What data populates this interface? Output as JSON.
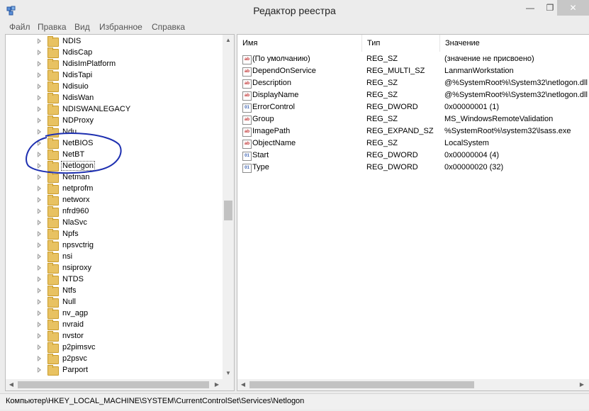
{
  "window": {
    "title": "Редактор реестра",
    "minimize_glyph": "—",
    "maximize_glyph": "❐",
    "close_glyph": "✕"
  },
  "menu": [
    "Файл",
    "Правка",
    "Вид",
    "Избранное",
    "Справка"
  ],
  "tree": {
    "items": [
      {
        "label": "NDIS",
        "selected": false
      },
      {
        "label": "NdisCap",
        "selected": false
      },
      {
        "label": "NdisImPlatform",
        "selected": false
      },
      {
        "label": "NdisTapi",
        "selected": false
      },
      {
        "label": "Ndisuio",
        "selected": false
      },
      {
        "label": "NdisWan",
        "selected": false
      },
      {
        "label": "NDISWANLEGACY",
        "selected": false
      },
      {
        "label": "NDProxy",
        "selected": false
      },
      {
        "label": "Ndu",
        "selected": false
      },
      {
        "label": "NetBIOS",
        "selected": false
      },
      {
        "label": "NetBT",
        "selected": false
      },
      {
        "label": "Netlogon",
        "selected": true
      },
      {
        "label": "Netman",
        "selected": false
      },
      {
        "label": "netprofm",
        "selected": false
      },
      {
        "label": "networx",
        "selected": false
      },
      {
        "label": "nfrd960",
        "selected": false
      },
      {
        "label": "NlaSvc",
        "selected": false
      },
      {
        "label": "Npfs",
        "selected": false
      },
      {
        "label": "npsvctrig",
        "selected": false
      },
      {
        "label": "nsi",
        "selected": false
      },
      {
        "label": "nsiproxy",
        "selected": false
      },
      {
        "label": "NTDS",
        "selected": false
      },
      {
        "label": "Ntfs",
        "selected": false
      },
      {
        "label": "Null",
        "selected": false
      },
      {
        "label": "nv_agp",
        "selected": false
      },
      {
        "label": "nvraid",
        "selected": false
      },
      {
        "label": "nvstor",
        "selected": false
      },
      {
        "label": "p2pimsvc",
        "selected": false
      },
      {
        "label": "p2psvc",
        "selected": false
      },
      {
        "label": "Parport",
        "selected": false
      }
    ]
  },
  "list": {
    "columns": {
      "name": "Имя",
      "type": "Тип",
      "value": "Значение"
    },
    "rows": [
      {
        "icon": "string-value-icon",
        "glyph": "ab",
        "name": "(По умолчанию)",
        "type": "REG_SZ",
        "value": "(значение не присвоено)"
      },
      {
        "icon": "string-value-icon",
        "glyph": "ab",
        "name": "DependOnService",
        "type": "REG_MULTI_SZ",
        "value": "LanmanWorkstation"
      },
      {
        "icon": "string-value-icon",
        "glyph": "ab",
        "name": "Description",
        "type": "REG_SZ",
        "value": "@%SystemRoot%\\System32\\netlogon.dll"
      },
      {
        "icon": "string-value-icon",
        "glyph": "ab",
        "name": "DisplayName",
        "type": "REG_SZ",
        "value": "@%SystemRoot%\\System32\\netlogon.dll"
      },
      {
        "icon": "binary-value-icon",
        "glyph": "01",
        "name": "ErrorControl",
        "type": "REG_DWORD",
        "value": "0x00000001 (1)"
      },
      {
        "icon": "string-value-icon",
        "glyph": "ab",
        "name": "Group",
        "type": "REG_SZ",
        "value": "MS_WindowsRemoteValidation"
      },
      {
        "icon": "string-value-icon",
        "glyph": "ab",
        "name": "ImagePath",
        "type": "REG_EXPAND_SZ",
        "value": "%SystemRoot%\\system32\\lsass.exe"
      },
      {
        "icon": "string-value-icon",
        "glyph": "ab",
        "name": "ObjectName",
        "type": "REG_SZ",
        "value": "LocalSystem"
      },
      {
        "icon": "binary-value-icon",
        "glyph": "01",
        "name": "Start",
        "type": "REG_DWORD",
        "value": "0x00000004 (4)"
      },
      {
        "icon": "binary-value-icon",
        "glyph": "01",
        "name": "Type",
        "type": "REG_DWORD",
        "value": "0x00000020 (32)"
      }
    ]
  },
  "status": {
    "path": "Компьютер\\HKEY_LOCAL_MACHINE\\SYSTEM\\CurrentControlSet\\Services\\Netlogon"
  },
  "colors": {
    "folder": "#e8c262",
    "annotation": "#1d2fb0"
  }
}
